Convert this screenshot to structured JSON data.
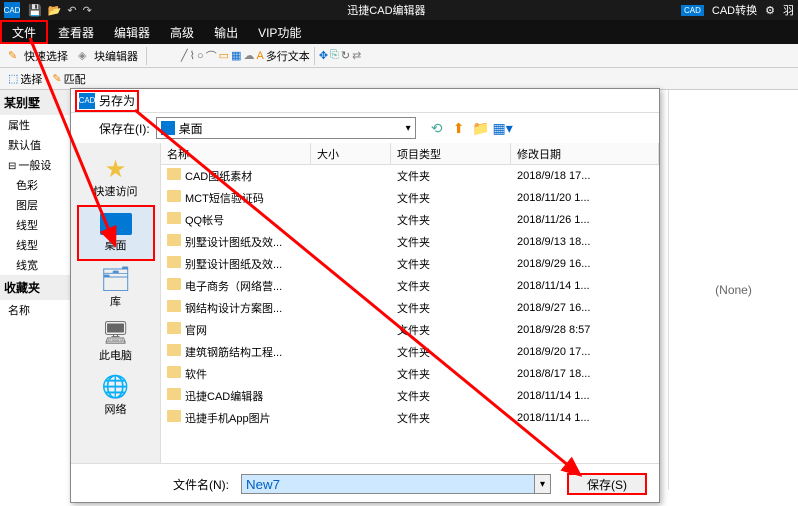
{
  "app": {
    "title": "迅捷CAD编辑器",
    "icon": "CAD",
    "cad_convert": "CAD转换",
    "user": "羽"
  },
  "menu": [
    "文件",
    "查看器",
    "编辑器",
    "高级",
    "输出",
    "VIP功能"
  ],
  "toolbar1": {
    "quick_select": "快速选择",
    "block_editor": "块编辑器",
    "multiline_text": "多行文本"
  },
  "toolbar2": {
    "select": "选择",
    "match": "匹配"
  },
  "left": {
    "section1": "某别墅",
    "props": "属性",
    "default": "默认值",
    "general": "一般设",
    "rows": [
      "色彩",
      "图层",
      "线型",
      "线型",
      "线宽"
    ],
    "favorites": "收藏夹",
    "name": "名称"
  },
  "dialog": {
    "title": "另存为",
    "save_in_label": "保存在(I):",
    "save_in_value": "桌面",
    "columns": {
      "name": "名称",
      "size": "大小",
      "type": "项目类型",
      "date": "修改日期"
    },
    "places": {
      "quick": "快速访问",
      "desktop": "桌面",
      "lib": "库",
      "pc": "此电脑",
      "net": "网络"
    },
    "rows": [
      {
        "name": "CAD图纸素材",
        "type": "文件夹",
        "date": "2018/9/18 17..."
      },
      {
        "name": "MCT短信验证码",
        "type": "文件夹",
        "date": "2018/11/20 1..."
      },
      {
        "name": "QQ帐号",
        "type": "文件夹",
        "date": "2018/11/26 1..."
      },
      {
        "name": "别墅设计图纸及效...",
        "type": "文件夹",
        "date": "2018/9/13 18..."
      },
      {
        "name": "别墅设计图纸及效...",
        "type": "文件夹",
        "date": "2018/9/29 16..."
      },
      {
        "name": "电子商务（网络营...",
        "type": "文件夹",
        "date": "2018/11/14 1..."
      },
      {
        "name": "钢结构设计方案图...",
        "type": "文件夹",
        "date": "2018/9/27 16..."
      },
      {
        "name": "官网",
        "type": "文件夹",
        "date": "2018/9/28 8:57"
      },
      {
        "name": "建筑钢筋结构工程...",
        "type": "文件夹",
        "date": "2018/9/20 17..."
      },
      {
        "name": "软件",
        "type": "文件夹",
        "date": "2018/8/17 18..."
      },
      {
        "name": "迅捷CAD编辑器",
        "type": "文件夹",
        "date": "2018/11/14 1..."
      },
      {
        "name": "迅捷手机App图片",
        "type": "文件夹",
        "date": "2018/11/14 1..."
      }
    ],
    "filename_label": "文件名(N):",
    "filename_value": "New7",
    "save_btn": "保存(S)"
  },
  "right": {
    "none": "(None)"
  }
}
